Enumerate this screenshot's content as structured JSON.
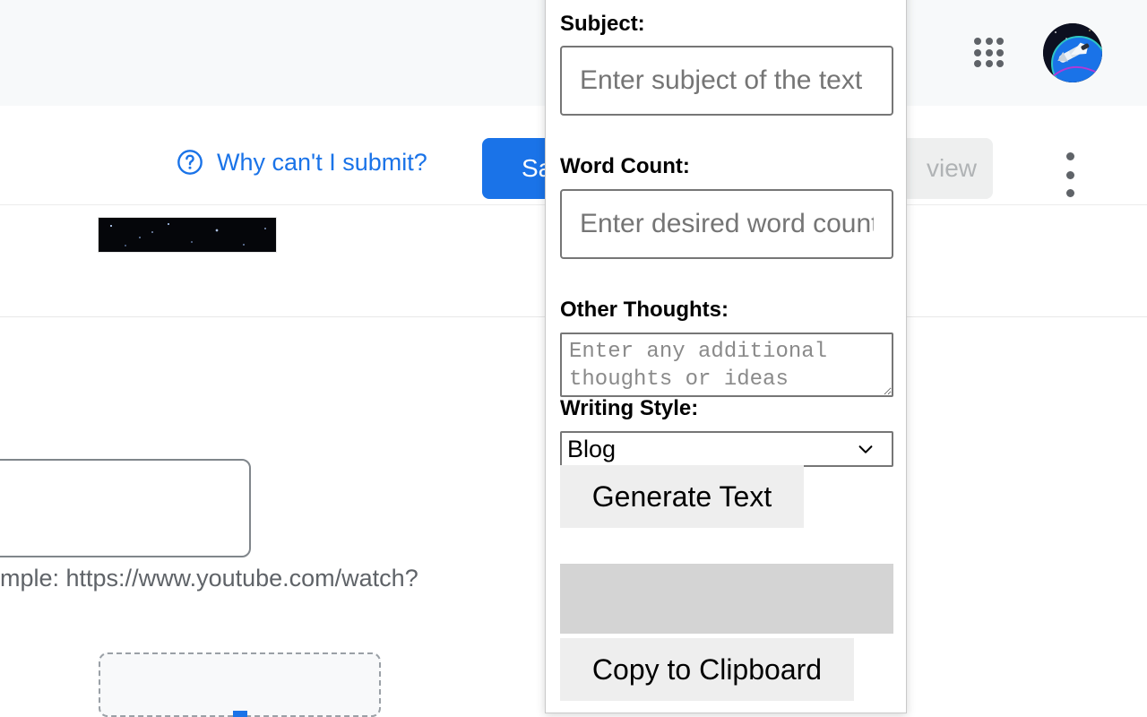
{
  "background": {
    "header": {
      "apps_icon": "apps-grid-icon",
      "avatar_icon": "space-shuttle-avatar"
    },
    "action_bar": {
      "help_icon": "help-circle-icon",
      "help_link": "Why can't I submit?",
      "save_label": "Sa",
      "preview_label": "view",
      "more_icon": "more-vertical-icon"
    },
    "content": {
      "thumbnail": "starfield-thumbnail",
      "url_hint": "mple: https://www.youtube.com/watch?",
      "dropzone": "file-dropzone"
    }
  },
  "popup": {
    "subject": {
      "label": "Subject:",
      "placeholder": "Enter subject of the text",
      "value": ""
    },
    "word_count": {
      "label": "Word Count:",
      "placeholder": "Enter desired word count",
      "value": ""
    },
    "other_thoughts": {
      "label": "Other Thoughts:",
      "placeholder": "Enter any additional thoughts or ideas",
      "value": ""
    },
    "writing_style": {
      "label": "Writing Style:",
      "selected": "Blog",
      "options": [
        "Blog"
      ],
      "chevron_icon": "chevron-down-icon"
    },
    "generate_button": "Generate Text",
    "output_box": "",
    "copy_button": "Copy to Clipboard"
  },
  "colors": {
    "accent_blue": "#1a73e8",
    "header_bg": "#f7f9fa",
    "button_gray": "#eeeeee",
    "output_gray": "#d4d4d4",
    "input_border": "#767676"
  }
}
